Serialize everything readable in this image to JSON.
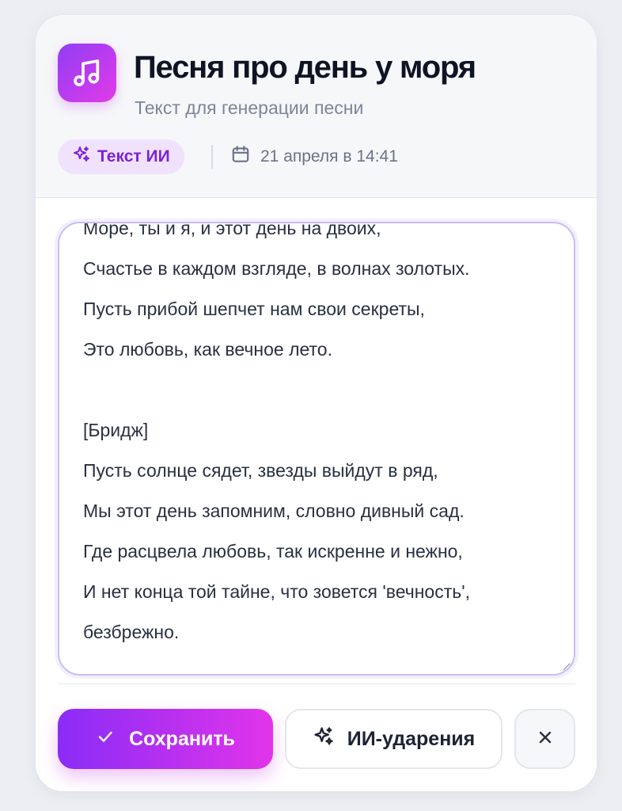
{
  "header": {
    "title": "Песня про день у моря",
    "subtitle": "Текст для генерации песни",
    "badge_label": "Текст ИИ",
    "date_label": "21 апреля в 14:41",
    "app_icon": "music-note-icon"
  },
  "editor": {
    "lines": [
      "Море, ты и я, и этот день на двоих,",
      "Счастье в каждом взгляде, в волнах золотых.",
      "Пусть прибой шепчет нам свои секреты,",
      "Это любовь, как вечное лето.",
      "",
      "[Бридж]",
      "Пусть солнце сядет, звезды выйдут в ряд,",
      "Мы этот день запомним, словно дивный сад.",
      "Где расцвела любовь, так искренне и нежно,",
      "И нет конца той тайне, что зовется 'вечность',",
      "безбрежно."
    ]
  },
  "actions": {
    "save_label": "Сохранить",
    "stress_label": "ИИ-ударения",
    "close_icon": "close-icon"
  },
  "colors": {
    "accent_start": "#8a2cf6",
    "accent_end": "#e134ea",
    "badge_bg": "#f0e2fd",
    "badge_text": "#7c22d6"
  }
}
